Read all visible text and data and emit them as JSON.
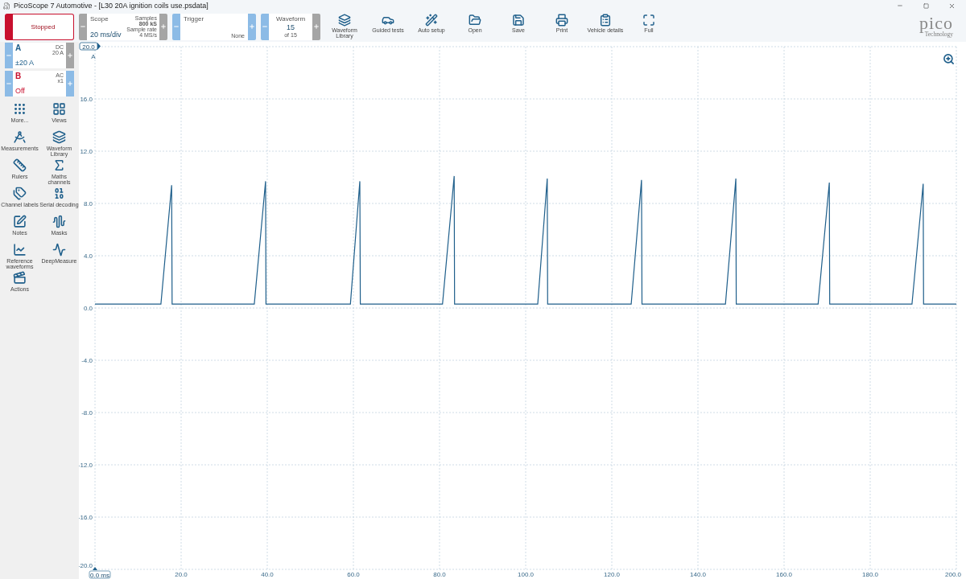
{
  "window": {
    "title": "PicoScope 7 Automotive - [L30 20A ignition coils use.psdata]"
  },
  "run_button": {
    "label": "Stopped"
  },
  "scope": {
    "label": "Scope",
    "value": "20 ms/div",
    "samples_label": "Samples",
    "samples": "800 kS",
    "rate_label": "Sample rate",
    "rate": "4 MS/s",
    "minus_disabled": true,
    "plus_disabled": true
  },
  "trigger": {
    "label": "Trigger",
    "mode": "None",
    "minus_disabled": false,
    "plus_disabled": false
  },
  "waveform": {
    "label": "Waveform",
    "value": "15",
    "total": "of 15",
    "minus_disabled": false,
    "plus_disabled": true
  },
  "toolbar": [
    {
      "label": "Waveform Library",
      "kind": "library"
    },
    {
      "label": "Guided tests",
      "kind": "car"
    },
    {
      "label": "Auto setup",
      "kind": "wand"
    },
    {
      "label": "Open",
      "kind": "open"
    },
    {
      "label": "Save",
      "kind": "save"
    },
    {
      "label": "Print",
      "kind": "print"
    },
    {
      "label": "Vehicle details",
      "kind": "clipboard"
    },
    {
      "label": "Full",
      "kind": "fullscreen"
    }
  ],
  "logo": {
    "name": "pico",
    "tagline": "Technology"
  },
  "channels": [
    {
      "name": "A",
      "coupling": "DC",
      "range_short": "20 A",
      "range": "±20 A",
      "color": "#1f5f8b",
      "minus_disabled": false,
      "plus_disabled": true
    },
    {
      "name": "B",
      "coupling": "AC",
      "range_short": "x1",
      "range": "Off",
      "color": "#c8102e",
      "minus_disabled": false,
      "plus_disabled": false
    }
  ],
  "tools": [
    {
      "label": "More...",
      "kind": "more"
    },
    {
      "label": "Views",
      "kind": "views"
    },
    {
      "label": "Measurements",
      "kind": "compass"
    },
    {
      "label": "Waveform Library",
      "kind": "library"
    },
    {
      "label": "Rulers",
      "kind": "ruler"
    },
    {
      "label": "Maths channels",
      "kind": "sigma"
    },
    {
      "label": "Channel labels",
      "kind": "tags"
    },
    {
      "label": "Serial decoding",
      "kind": "binary"
    },
    {
      "label": "Notes",
      "kind": "notes"
    },
    {
      "label": "Masks",
      "kind": "mask"
    },
    {
      "label": "Reference waveforms",
      "kind": "reference"
    },
    {
      "label": "DeepMeasure",
      "kind": "deep"
    },
    {
      "label": "Actions",
      "kind": "actions"
    }
  ],
  "chart": {
    "chart_data": {
      "type": "line",
      "grid": true,
      "xlim": [
        0,
        200
      ],
      "ylim": [
        -20,
        20
      ],
      "xticks": [
        {
          "value": 0,
          "label": "0.0 ms"
        },
        {
          "value": 20,
          "label": "20.0"
        },
        {
          "value": 40,
          "label": "40.0"
        },
        {
          "value": 60,
          "label": "60.0"
        },
        {
          "value": 80,
          "label": "80.0"
        },
        {
          "value": 100,
          "label": "100.0"
        },
        {
          "value": 120,
          "label": "120.0"
        },
        {
          "value": 140,
          "label": "140.0"
        },
        {
          "value": 160,
          "label": "160.0"
        },
        {
          "value": 180,
          "label": "180.0"
        },
        {
          "value": 200,
          "label": "200.0"
        }
      ],
      "yticks": [
        {
          "value": -20,
          "label": "-20.0"
        },
        {
          "value": -16,
          "label": "-16.0"
        },
        {
          "value": -12,
          "label": "-12.0"
        },
        {
          "value": -8,
          "label": "-8.0"
        },
        {
          "value": -4,
          "label": "-4.0"
        },
        {
          "value": 0,
          "label": "0.0"
        },
        {
          "value": 4,
          "label": "4.0"
        },
        {
          "value": 8,
          "label": "8.0"
        },
        {
          "value": 12,
          "label": "12.0"
        },
        {
          "value": 16,
          "label": "16.0"
        },
        {
          "value": 20,
          "label": "20.0"
        }
      ],
      "x": [
        0,
        15.3,
        17.8,
        17.9,
        37,
        39.6,
        39.7,
        59.3,
        61.5,
        61.6,
        80.7,
        83.4,
        83.5,
        102.8,
        105,
        105.1,
        124.5,
        126.9,
        127,
        146.4,
        148.8,
        148.9,
        167.9,
        170.5,
        170.6,
        189.7,
        192.3,
        192.4,
        200
      ],
      "series": [
        {
          "name": "A",
          "color": "#1f5f8b",
          "values": [
            0.3,
            0.3,
            9.4,
            0.3,
            0.3,
            9.7,
            0.3,
            0.3,
            9.7,
            0.3,
            0.3,
            10.1,
            0.3,
            0.3,
            9.9,
            0.3,
            0.3,
            9.8,
            0.3,
            0.3,
            9.9,
            0.3,
            0.3,
            9.6,
            0.3,
            0.3,
            9.5,
            0.3,
            0.3
          ]
        }
      ]
    }
  }
}
